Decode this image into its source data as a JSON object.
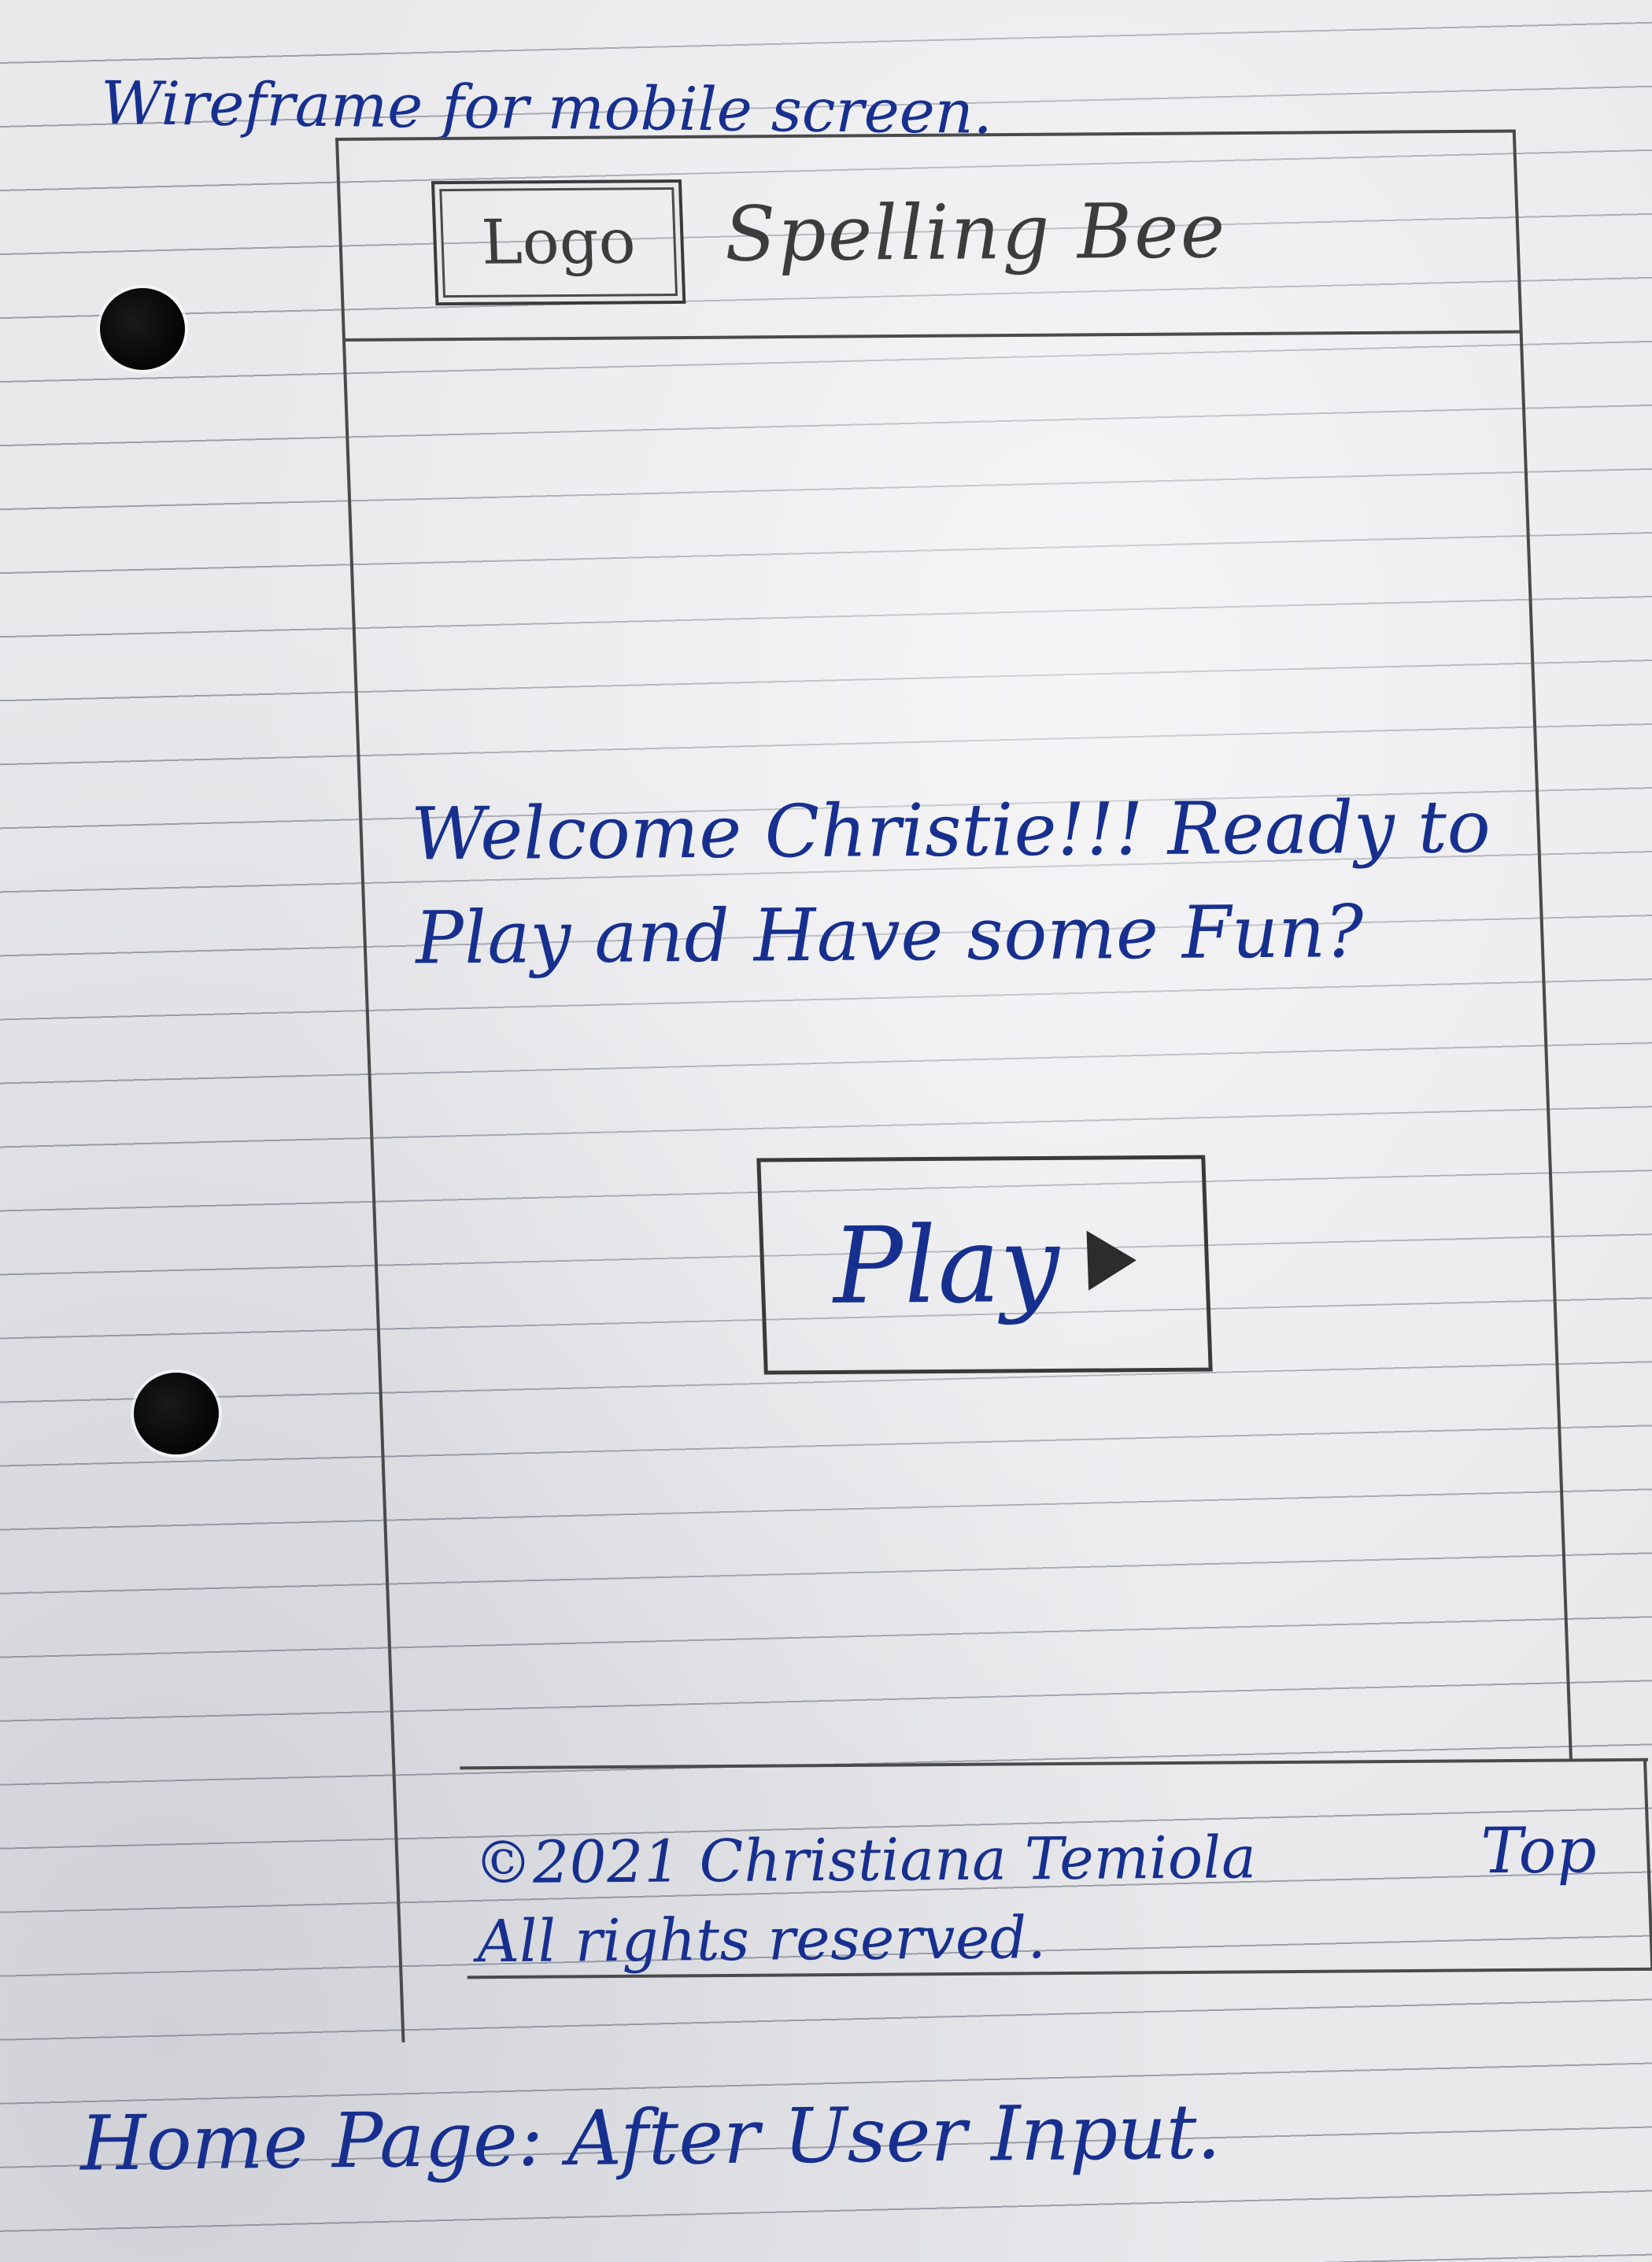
{
  "captions": {
    "top": "Wireframe for mobile screen.",
    "bottom": "Home Page: After User Input."
  },
  "header": {
    "logo_placeholder": "Logo",
    "app_title": "Spelling Bee"
  },
  "main": {
    "welcome_message": "Welcome Christie!!! Ready to Play and Have some Fun?",
    "play_button_label": "Play",
    "play_icon": "play-triangle-icon"
  },
  "footer": {
    "copyright": "©2021 Christiana Temiola",
    "rights": "All rights reserved.",
    "top_link": "Top"
  },
  "colors": {
    "paper": "#e9e9ec",
    "ink": "#17308f",
    "pencil": "#3c3c3c"
  }
}
